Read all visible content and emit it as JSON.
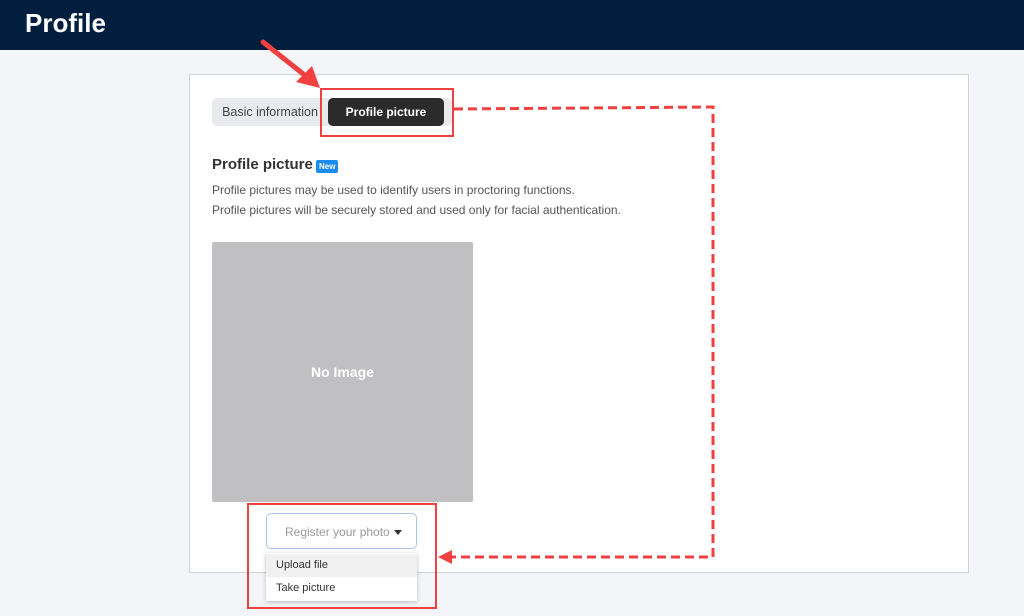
{
  "header": {
    "title": "Profile"
  },
  "tabs": {
    "basic_label": "Basic information",
    "picture_label": "Profile picture"
  },
  "section": {
    "title": "Profile picture",
    "badge": "New",
    "desc_line1": "Profile pictures may be used to identify users in proctoring functions.",
    "desc_line2": "Profile pictures will be securely stored and used only for facial authentication."
  },
  "image_placeholder": {
    "text": "No Image"
  },
  "register": {
    "label": "Register your photo",
    "options": [
      "Upload file",
      "Take picture"
    ]
  },
  "colors": {
    "header_bg": "#011e3e",
    "active_tab": "#2b2b2b",
    "badge": "#1a8cf0",
    "highlight": "#ef4141"
  }
}
